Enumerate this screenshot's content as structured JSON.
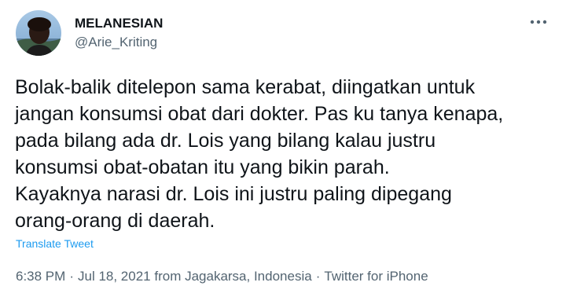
{
  "author": {
    "display_name": "MELANESIAN",
    "handle": "@Arie_Kriting"
  },
  "icons": {
    "more": "more-horizontal-icon",
    "avatar": "profile-photo"
  },
  "tweet": {
    "lines": [
      "Bolak-balik ditelepon sama kerabat, diingatkan untuk",
      "jangan konsumsi obat dari dokter. Pas ku tanya kenapa,",
      "pada bilang ada dr. Lois yang bilang kalau justru",
      "konsumsi obat-obatan itu yang bikin parah.",
      "Kayaknya narasi dr. Lois ini justru paling dipegang",
      "orang-orang di daerah."
    ],
    "translate_label": "Translate Tweet"
  },
  "meta": {
    "time": "6:38 PM",
    "date": "Jul 18, 2021",
    "location": "from Jagakarsa, Indonesia",
    "source": "Twitter for iPhone",
    "separator": "·"
  },
  "colors": {
    "text": "#0f1419",
    "secondary": "#536471",
    "link": "#1d9bf0"
  }
}
